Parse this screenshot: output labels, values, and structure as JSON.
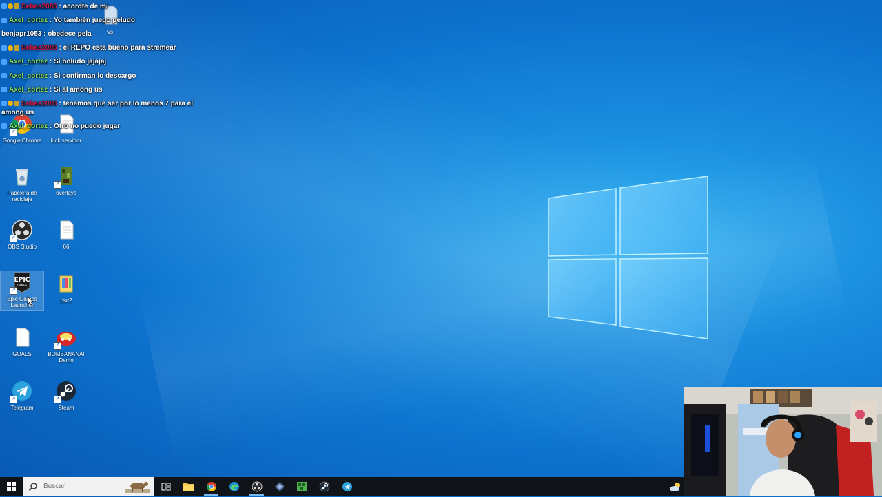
{
  "chat": {
    "messages": [
      {
        "badges": [
          "mod",
          "one",
          "sub"
        ],
        "user": "Sebas2086",
        "user_style": "red",
        "text": ": acordte de mi"
      },
      {
        "badges": [
          "mod"
        ],
        "user": "Axel_cortez",
        "user_style": "green",
        "text": ": Yo también juego peludo"
      },
      {
        "badges": [],
        "user": "benjapr1053",
        "user_style": "white",
        "text": ": obedece pela"
      },
      {
        "badges": [
          "mod",
          "one",
          "sub"
        ],
        "user": "Sebas2086",
        "user_style": "red",
        "text": ": el REPO esta bueno para stremear"
      },
      {
        "badges": [
          "mod"
        ],
        "user": "Axel_cortez",
        "user_style": "green",
        "text": ": Si boludo jajajaj"
      },
      {
        "badges": [
          "mod"
        ],
        "user": "Axel_cortez",
        "user_style": "green",
        "text": ": Si confirman lo descargo"
      },
      {
        "badges": [
          "mod"
        ],
        "user": "Axel_cortez",
        "user_style": "green",
        "text": ": Si al among us"
      },
      {
        "badges": [
          "mod",
          "one",
          "sub"
        ],
        "user": "Sebas2086",
        "user_style": "red",
        "text": ": tenemos que ser por lo menos 7 para el among us"
      },
      {
        "badges": [
          "mod"
        ],
        "user": "Axel_cortez",
        "user_style": "green",
        "text": ": Otro no puedo jugar"
      }
    ]
  },
  "desktop": {
    "icons": [
      {
        "label": "Google Chrome",
        "icon": "chrome-icon"
      },
      {
        "label": "kick servidor",
        "icon": "file-icon"
      },
      {
        "label": "vs",
        "icon": "file-icon"
      },
      {
        "label": "Papelera de reciclaje",
        "icon": "recycle-bin-icon"
      },
      {
        "label": "overlays",
        "icon": "minecraft-icon"
      },
      {
        "label": "OBS Studio",
        "icon": "obs-icon"
      },
      {
        "label": "66",
        "icon": "file-icon"
      },
      {
        "label": "Epic Games Launcher",
        "icon": "epic-games-icon"
      },
      {
        "label": "psc2",
        "icon": "folder-icon"
      },
      {
        "label": "GOALS",
        "icon": "file-icon"
      },
      {
        "label": "BOMBANANA! Demo",
        "icon": "bombanana-icon"
      },
      {
        "label": "Telegram",
        "icon": "telegram-icon"
      },
      {
        "label": "Steam",
        "icon": "steam-icon"
      }
    ]
  },
  "taskbar": {
    "search_placeholder": "Buscar",
    "apps": [
      "task-view-icon",
      "file-explorer-icon",
      "chrome-icon",
      "edge-icon",
      "obs-icon",
      "game-icon",
      "minecraft-icon",
      "steam-icon",
      "telegram-icon"
    ],
    "tray": "weather-icon"
  },
  "colors": {
    "desktop_bg": "#0d74cf",
    "taskbar_bg": "#101318",
    "chat_red": "#d4194a",
    "chat_green": "#7fe36c"
  }
}
